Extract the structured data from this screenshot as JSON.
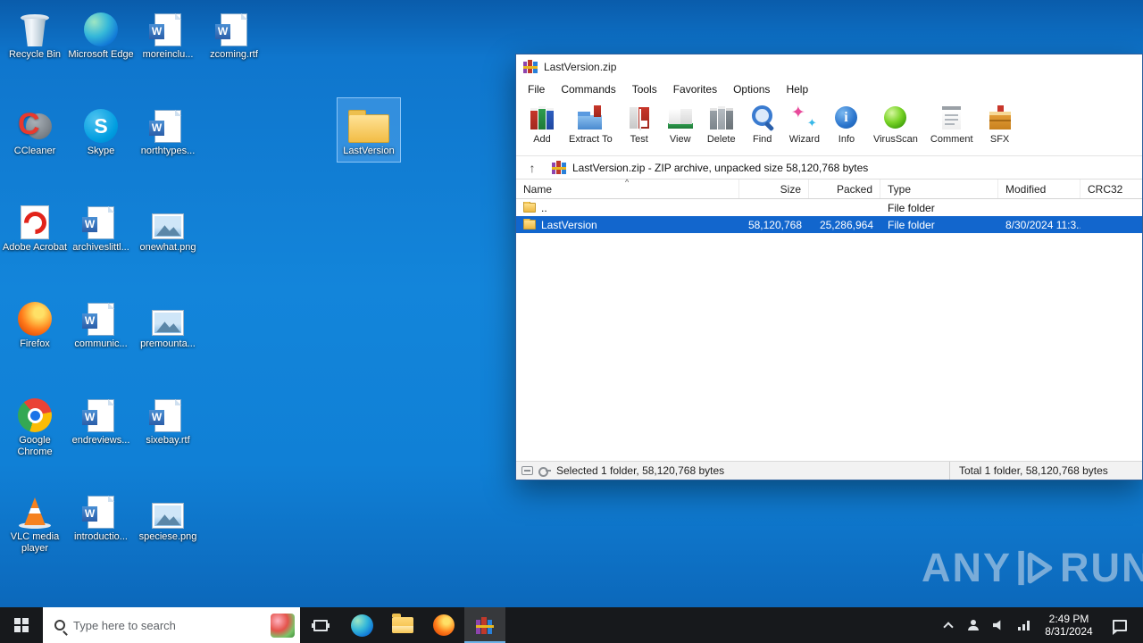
{
  "desktop": {
    "icons": [
      {
        "label": "Recycle Bin",
        "type": "recycle-bin"
      },
      {
        "label": "Microsoft Edge",
        "type": "edge"
      },
      {
        "label": "moreinclu...",
        "type": "word"
      },
      {
        "label": "zcoming.rtf",
        "type": "word"
      },
      {
        "label": "CCleaner",
        "type": "ccleaner"
      },
      {
        "label": "Skype",
        "type": "skype"
      },
      {
        "label": "northtypes...",
        "type": "word"
      },
      {
        "label": "Adobe Acrobat",
        "type": "acrobat"
      },
      {
        "label": "archiveslittl...",
        "type": "word"
      },
      {
        "label": "onewhat.png",
        "type": "image"
      },
      {
        "label": "Firefox",
        "type": "firefox"
      },
      {
        "label": "communic...",
        "type": "word"
      },
      {
        "label": "premounta...",
        "type": "image"
      },
      {
        "label": "Google Chrome",
        "type": "chrome"
      },
      {
        "label": "endreviews...",
        "type": "word"
      },
      {
        "label": "sixebay.rtf",
        "type": "word"
      },
      {
        "label": "VLC media player",
        "type": "vlc"
      },
      {
        "label": "introductio...",
        "type": "word"
      },
      {
        "label": "speciese.png",
        "type": "image"
      }
    ],
    "selected_icon": {
      "label": "LastVersion",
      "type": "folder"
    }
  },
  "winrar": {
    "title": "LastVersion.zip",
    "menu": [
      "File",
      "Commands",
      "Tools",
      "Favorites",
      "Options",
      "Help"
    ],
    "toolbar": [
      "Add",
      "Extract To",
      "Test",
      "View",
      "Delete",
      "Find",
      "Wizard",
      "Info",
      "VirusScan",
      "Comment",
      "SFX"
    ],
    "address": "LastVersion.zip - ZIP archive, unpacked size 58,120,768 bytes",
    "columns": [
      "Name",
      "Size",
      "Packed",
      "Type",
      "Modified",
      "CRC32"
    ],
    "rows": [
      {
        "name": "..",
        "size": "",
        "packed": "",
        "type": "File folder",
        "modified": "",
        "crc32": ""
      },
      {
        "name": "LastVersion",
        "size": "58,120,768",
        "packed": "25,286,964",
        "type": "File folder",
        "modified": "8/30/2024 11:3...",
        "crc32": ""
      }
    ],
    "status": {
      "selected": "Selected 1 folder, 58,120,768 bytes",
      "total": "Total 1 folder, 58,120,768 bytes"
    }
  },
  "taskbar": {
    "search_placeholder": "Type here to search",
    "clock": {
      "time": "2:49 PM",
      "date": "8/31/2024"
    }
  },
  "watermark": {
    "any": "ANY",
    "run": "RUN"
  }
}
